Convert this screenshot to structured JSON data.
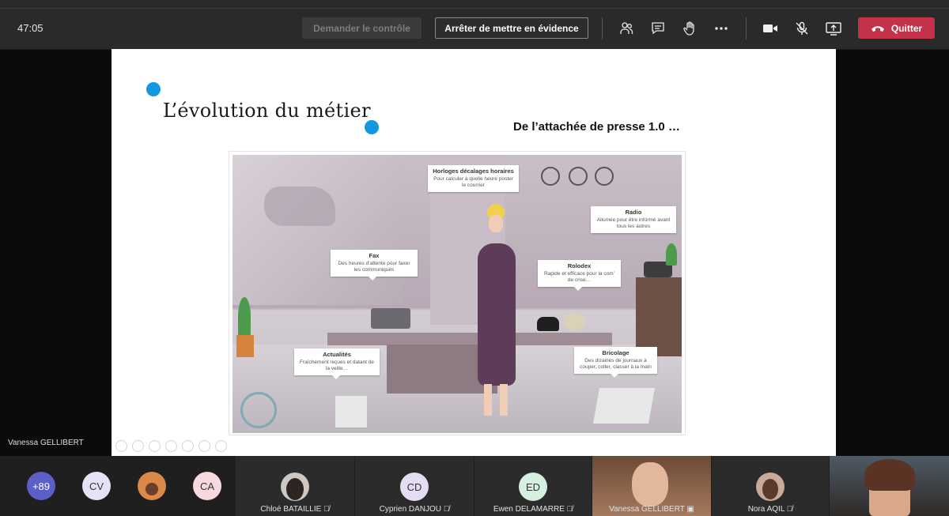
{
  "meeting": {
    "timer": "47:05",
    "request_control_label": "Demander le contrôle",
    "stop_spotlight_label": "Arrêter de mettre en évidence",
    "quit_label": "Quitter",
    "colors": {
      "quit": "#c4314b",
      "accent_dot": "#1397e3"
    }
  },
  "toolbar_icons": [
    "participants-icon",
    "chat-icon",
    "raise-hand-icon",
    "more-icon",
    "camera-icon",
    "mic-muted-icon",
    "share-screen-icon"
  ],
  "slide": {
    "title": "L’évolution du métier",
    "subtitle": "De l’attachée de presse 1.0 …",
    "callouts": {
      "horloges": {
        "title": "Horloges décalages horaires",
        "text": "Pour calculer à quelle heure poster le courrier"
      },
      "radio": {
        "title": "Radio",
        "text": "Allumée pour être informé avant tous les autres"
      },
      "fax": {
        "title": "Fax",
        "text": "Des heures d’attente pour faxer les communiqués"
      },
      "rolodex": {
        "title": "Rolodex",
        "text": "Rapide et efficace pour la com’ de crise…"
      },
      "actualites": {
        "title": "Actualités",
        "text": "Fraîchement reçues et datant de la veille…"
      },
      "bricolage": {
        "title": "Bricolage",
        "text": "Des dizaines de journaux à couper, coller, classer à la main"
      }
    },
    "presenter": "Vanessa GELLIBERT"
  },
  "participants_strip": {
    "overflow_count": "+89",
    "bubbles": [
      {
        "initials": "CV",
        "color": "#e8e2f7"
      },
      {
        "initials": "",
        "color": "#d9894a"
      },
      {
        "initials": "CA",
        "color": "#f8d9df"
      }
    ],
    "tiles": [
      {
        "name": "Chloé BATAILLIE",
        "initials": "",
        "color": "#cfc7c2"
      },
      {
        "name": "Cyprien DANJOU",
        "initials": "CD",
        "color": "#e4ddf4"
      },
      {
        "name": "Ewen DELAMARRE",
        "initials": "ED",
        "color": "#d5f0e0"
      },
      {
        "name": "Vanessa GELLIBERT",
        "initials": "",
        "color": "#b07a5a"
      },
      {
        "name": "Nora AQIL",
        "initials": "",
        "color": "#c9a99a"
      }
    ]
  }
}
